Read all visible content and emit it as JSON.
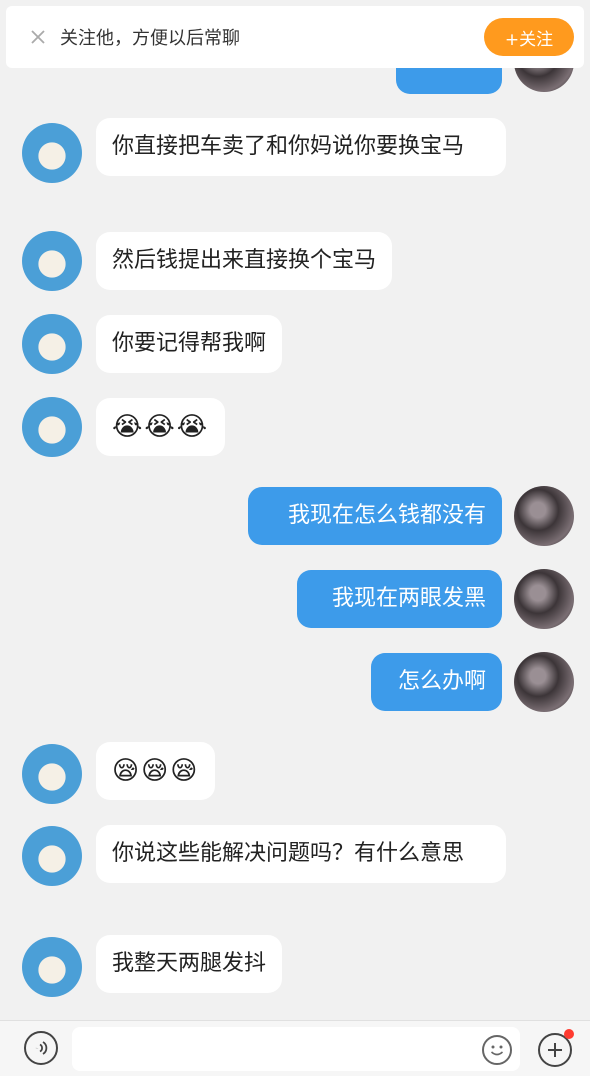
{
  "follow_bar": {
    "text": "关注他，方便以后常聊",
    "button": "+关注"
  },
  "messages": [
    {
      "side": "right",
      "text": "",
      "partial": true
    },
    {
      "side": "left",
      "text": "你直接把车卖了和你妈说你要换宝马"
    },
    {
      "side": "left",
      "text": "然后钱提出来直接换个宝马"
    },
    {
      "side": "left",
      "text": "你要记得帮我啊"
    },
    {
      "side": "left",
      "text": "😭😭😭"
    },
    {
      "side": "right",
      "text": "我现在怎么钱都没有"
    },
    {
      "side": "right",
      "text": "我现在两眼发黑"
    },
    {
      "side": "right",
      "text": "怎么办啊"
    },
    {
      "side": "left",
      "text": "😪😪😪"
    },
    {
      "side": "left",
      "text": "你说这些能解决问题吗？有什么意思"
    },
    {
      "side": "left",
      "text": "我整天两腿发抖"
    }
  ],
  "colors": {
    "accent_orange": "#ff9a1e",
    "bubble_blue": "#3d9bea",
    "background": "#f1f1f1",
    "notification_dot": "#ff3b30"
  },
  "icons": {
    "close": "close-icon",
    "voice": "voice-icon",
    "emoji": "emoji-icon",
    "plus": "plus-icon"
  }
}
